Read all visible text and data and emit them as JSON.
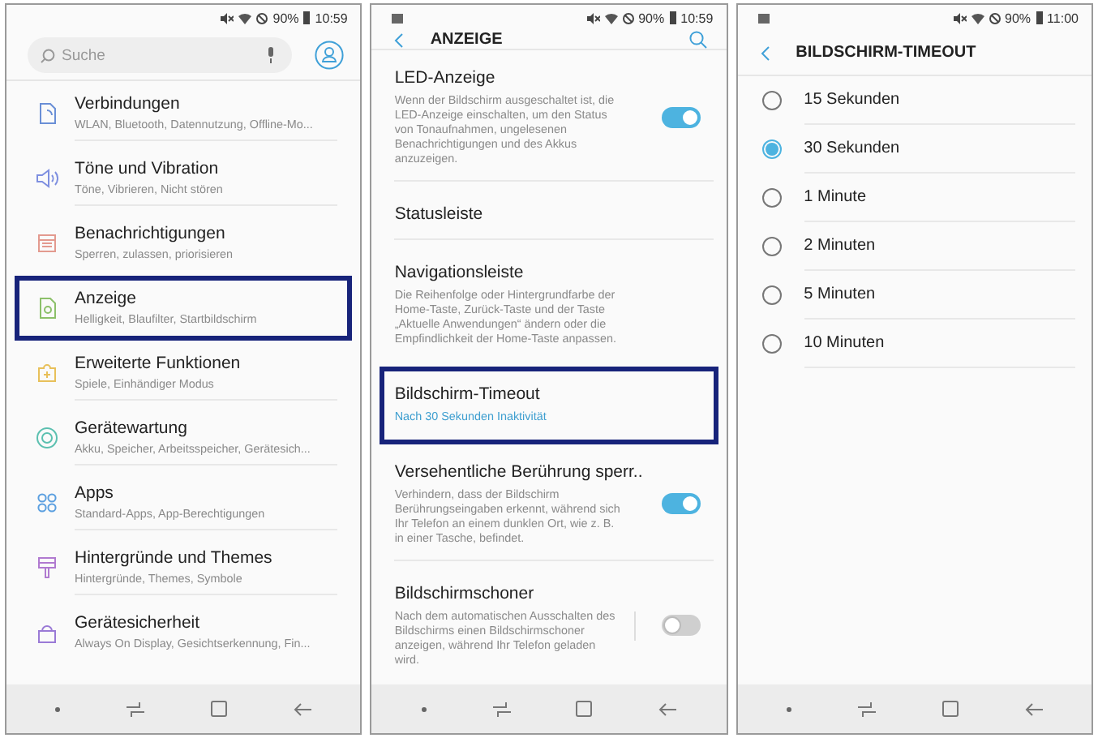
{
  "screens": [
    {
      "kind": "settings",
      "status": {
        "image_notification": false,
        "battery": "90%",
        "time": "10:59"
      },
      "search": {
        "placeholder": "Suche"
      },
      "items": [
        {
          "title": "Verbindungen",
          "subtitle": "WLAN, Bluetooth, Datennutzung, Offline-Mo...",
          "color": "#6a8fd6",
          "highlighted": false
        },
        {
          "title": "Töne und Vibration",
          "subtitle": "Töne, Vibrieren, Nicht stören",
          "color": "#7e8fe0",
          "highlighted": false
        },
        {
          "title": "Benachrichtigungen",
          "subtitle": "Sperren, zulassen, priorisieren",
          "color": "#e39a8f",
          "highlighted": false
        },
        {
          "title": "Anzeige",
          "subtitle": "Helligkeit, Blaufilter, Startbildschirm",
          "color": "#8cc06a",
          "highlighted": true
        },
        {
          "title": "Erweiterte Funktionen",
          "subtitle": "Spiele, Einhändiger Modus",
          "color": "#e8c05a",
          "highlighted": false
        },
        {
          "title": "Gerätewartung",
          "subtitle": "Akku, Speicher, Arbeitsspeicher, Gerätesich...",
          "color": "#5cc0b0",
          "highlighted": false
        },
        {
          "title": "Apps",
          "subtitle": "Standard-Apps, App-Berechtigungen",
          "color": "#5a9fe0",
          "highlighted": false
        },
        {
          "title": "Hintergründe und Themes",
          "subtitle": "Hintergründe, Themes, Symbole",
          "color": "#b07ad0",
          "highlighted": false
        },
        {
          "title": "Gerätesicherheit",
          "subtitle": "Always On Display, Gesichtserkennung, Fin...",
          "color": "#9a7ad6",
          "highlighted": false
        }
      ]
    },
    {
      "kind": "display",
      "status": {
        "image_notification": true,
        "battery": "90%",
        "time": "10:59"
      },
      "header": {
        "title": "ANZEIGE"
      },
      "items": [
        {
          "title": "LED-Anzeige",
          "description": "Wenn der Bildschirm ausgeschaltet ist, die LED-Anzeige einschalten, um den Status von Tonaufnahmen, ungelesenen Benachrichtigungen und des Akkus anzuzeigen.",
          "toggle": {
            "on": true,
            "divider": false
          },
          "highlighted": false
        },
        {
          "title": "Statusleiste",
          "highlighted": false
        },
        {
          "title": "Navigationsleiste",
          "description": "Die Reihenfolge oder Hintergrundfarbe der Home-Taste, Zurück-Taste und der Taste „Aktuelle Anwendungen“ ändern oder die Empfindlichkeit der Home-Taste anpassen.",
          "highlighted": false
        },
        {
          "title": "Bildschirm-Timeout",
          "value": "Nach 30 Sekunden Inaktivität",
          "highlighted": true
        },
        {
          "title": "Versehentliche Berührung sperr..",
          "description": "Verhindern, dass der Bildschirm Berührungseingaben erkennt, während sich Ihr Telefon an einem dunklen Ort, wie z. B. in einer Tasche, befindet.",
          "toggle": {
            "on": true,
            "divider": false
          },
          "highlighted": false
        },
        {
          "title": "Bildschirmschoner",
          "description": "Nach dem automatischen Ausschalten des Bildschirms einen Bildschirmschoner anzeigen, während Ihr Telefon geladen wird.",
          "toggle": {
            "on": false,
            "divider": true
          },
          "highlighted": false
        }
      ]
    },
    {
      "kind": "timeout",
      "status": {
        "image_notification": true,
        "battery": "90%",
        "time": "11:00"
      },
      "header": {
        "title": "BILDSCHIRM-TIMEOUT"
      },
      "options": [
        {
          "label": "15 Sekunden",
          "selected": false
        },
        {
          "label": "30 Sekunden",
          "selected": true
        },
        {
          "label": "1 Minute",
          "selected": false
        },
        {
          "label": "2 Minuten",
          "selected": false
        },
        {
          "label": "5 Minuten",
          "selected": false
        },
        {
          "label": "10 Minuten",
          "selected": false
        }
      ]
    }
  ]
}
